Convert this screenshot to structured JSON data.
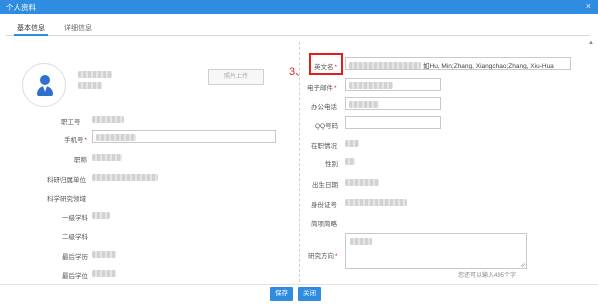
{
  "dialog": {
    "title": "个人资料",
    "close_icon": "×"
  },
  "tabs": [
    {
      "label": "基本信息"
    },
    {
      "label": "详细信息"
    }
  ],
  "photo": {
    "upload_label": "照片上传"
  },
  "left_fields": {
    "staff_no": "职工号",
    "phone": "手机号",
    "title": "职称",
    "unit": "科研归属单位",
    "field": "科学研究领域",
    "first_subject": "一级学科",
    "second_subject": "二级学科",
    "last_degree": "最后学历",
    "last_degree_level": "最后学位"
  },
  "right_fields": {
    "english_name": {
      "label": "英文名",
      "value": "如Hu, Min;Zhang, Xiangchao;Zhang, Xiu-Hua"
    },
    "email": "电子邮件",
    "office_phone": "办公电话",
    "qq": "QQ号码",
    "status": "在职情况",
    "gender": "性别",
    "birth_date": "出生日期",
    "id_card": "身份证号",
    "homepage": "简项简略",
    "research": "研究方向"
  },
  "annotation": {
    "step": "3、"
  },
  "hint": "您还可以输入495个字",
  "buttons": {
    "save": "保存",
    "close": "关闭"
  },
  "colors": {
    "primary": "#2f8ce0",
    "required": "#e02020",
    "annotation": "#e02020"
  }
}
